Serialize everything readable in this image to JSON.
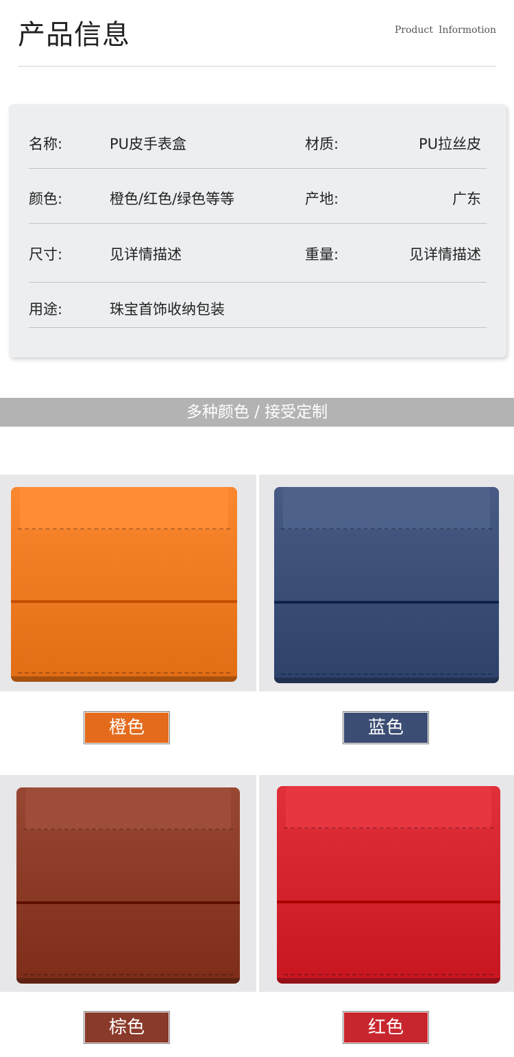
{
  "header": {
    "title": "产品信息",
    "subtitle_word1": "Product",
    "subtitle_word2": "Informotion"
  },
  "info": {
    "name_label": "名称:",
    "name_value": "PU皮手表盒",
    "material_label": "材质:",
    "material_value": "PU拉丝皮",
    "color_label": "颜色:",
    "color_value": "橙色/红色/绿色等等",
    "origin_label": "产地:",
    "origin_value": "广东",
    "size_label": "尺寸:",
    "size_value": "见详情描述",
    "weight_label": "重量:",
    "weight_value": "见详情描述",
    "usage_label": "用途:",
    "usage_value": "珠宝首饰收纳包装"
  },
  "banner": {
    "text": "多种颜色 / 接受定制"
  },
  "variants": [
    {
      "label": "橙色",
      "box_color": "#ef7b23",
      "tag_color": "#e46b1c"
    },
    {
      "label": "蓝色",
      "box_color": "#3b4f79",
      "tag_color": "#3c4d74"
    },
    {
      "label": "棕色",
      "box_color": "#8c3b27",
      "tag_color": "#8a3a2a"
    },
    {
      "label": "红色",
      "box_color": "#d6242f",
      "tag_color": "#c8262e"
    }
  ]
}
